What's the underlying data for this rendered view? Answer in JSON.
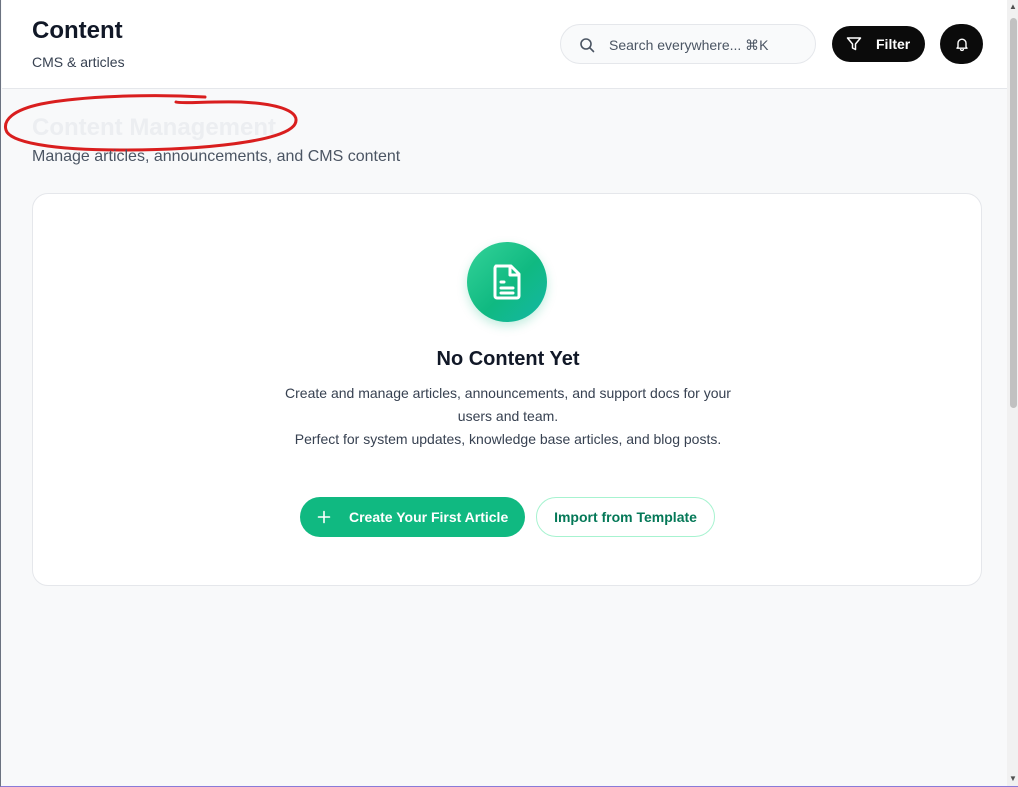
{
  "header": {
    "title": "Content",
    "subtitle": "CMS & articles",
    "search_placeholder": "Search everywhere... ⌘K",
    "filter_label": "Filter"
  },
  "page": {
    "heading": "Content Management",
    "description": "Manage articles, announcements, and CMS content"
  },
  "empty_state": {
    "title": "No Content Yet",
    "line1": "Create and manage articles, announcements, and support docs for your users and team.",
    "line2": "Perfect for system updates, knowledge base articles, and blog posts.",
    "primary_label": "Create Your First Article",
    "secondary_label": "Import from Template"
  },
  "icons": {
    "search": "search-icon",
    "filter": "filter-icon",
    "bell": "bell-icon",
    "document": "document-icon",
    "plus": "plus-icon"
  },
  "colors": {
    "accent": "#10b981",
    "dark_button": "#0b0b0b",
    "annotation": "#d91e1e"
  }
}
